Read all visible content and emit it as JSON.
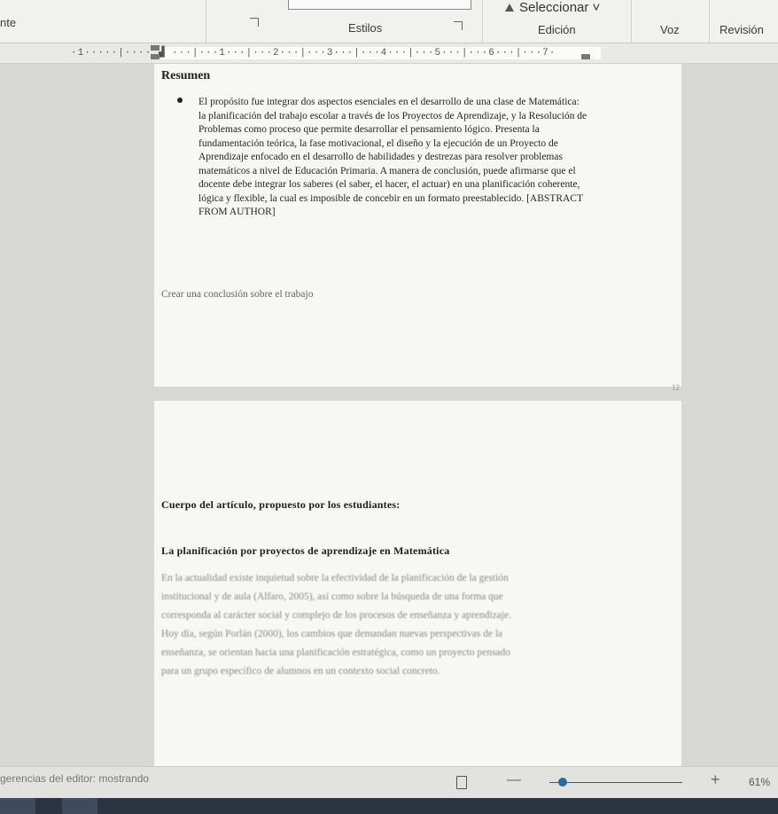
{
  "ribbon": {
    "left_fragment": "nte",
    "group_styles": "Estilos",
    "group_edit": "Edición",
    "group_voice": "Voz",
    "group_review": "Revisión",
    "select_button": "Seleccionar ˅"
  },
  "ruler": {
    "ticks": "·1·····|···· ▟ ···|···1···|···2···|···3···|···4···|···5···|···6···|···7·"
  },
  "page1": {
    "abstract_heading": "Resumen",
    "abstract_text": "El propósito fue integrar dos aspectos esenciales en el desarrollo de una clase de Matemática: la planificación del trabajo escolar a través de los Proyectos de Aprendizaje, y la Resolución de Problemas como proceso que permite desarrollar el pensamiento lógico. Presenta la fundamentación teórica, la fase motivacional, el diseño y la ejecución de un Proyecto de Aprendizaje enfocado en el desarrollo de habilidades y destrezas para resolver problemas matemáticos a nivel de Educación Primaria. A manera de conclusión, puede afirmarse que el docente debe integrar los saberes (el saber, el hacer, el actuar) en una planificación coherente, lógica y flexible, la cual es imposible de concebir en un formato preestablecido. [ABSTRACT FROM AUTHOR]",
    "conclusion_placeholder": "Crear una conclusión sobre el trabajo",
    "small_counter": "12"
  },
  "page2": {
    "body_heading": "Cuerpo del artículo, propuesto por los estudiantes:",
    "section_heading": "La planificación por proyectos de aprendizaje en Matemática",
    "section_text": "En la actualidad existe inquietud sobre la efectividad de la planificación de la gestión institucional y de aula (Alfaro, 2005), así como sobre la búsqueda de una forma que corresponda al carácter social y complejo de los procesos de enseñanza y aprendizaje. Hoy día, según Porlán (2000), los cambios que demandan nuevas perspectivas de la enseñanza, se orientan hacia una planificación estratégica, como un proyecto pensado para un grupo específico de alumnos en un contexto social concreto."
  },
  "status": {
    "message": "gerencias del editor: mostrando",
    "zoom_minus": "—",
    "zoom_plus": "+",
    "zoom_level": "61%",
    "zoom_fraction": 0.1
  },
  "colors": {
    "accent": "#1f6ea5",
    "page": "#f7f7f5",
    "desk": "#d7d7d5"
  }
}
